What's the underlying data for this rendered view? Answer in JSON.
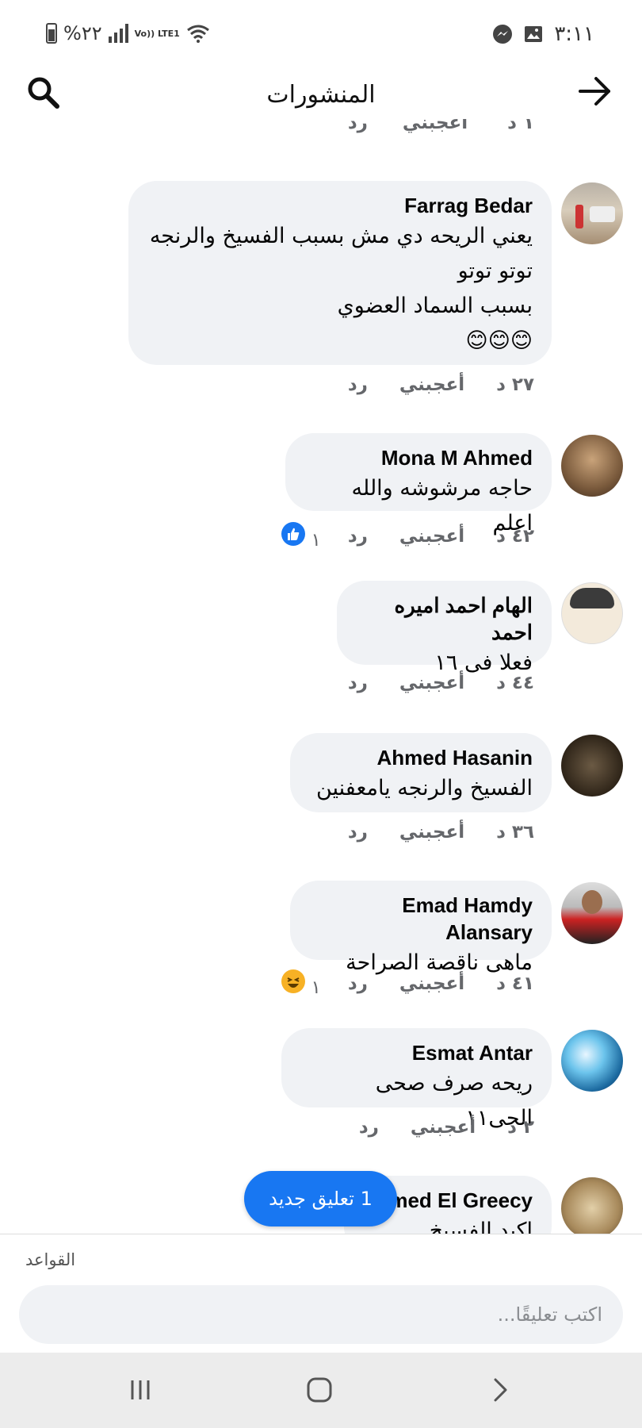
{
  "status_bar": {
    "time": "٣:١١",
    "battery": "%٢٢",
    "network": "Vo)) LTE1"
  },
  "header": {
    "title": "المنشورات",
    "search_icon": "search-icon",
    "back_icon": "arrow-right-icon"
  },
  "partial_top": {
    "time": "١ د",
    "like": "أعجبني",
    "reply": "رد"
  },
  "comments": [
    {
      "name": "Farrag Bedar",
      "text": "يعني الريحه دي مش بسبب الفسيخ والرنجه\nتوتو توتو\nبسبب السماد العضوي\n😊😊😊",
      "time": "٢٧ د",
      "like": "أعجبني",
      "reply": "رد",
      "reaction_count": ""
    },
    {
      "name": "Mona M Ahmed",
      "text": "حاجه مرشوشه والله اعلم",
      "time": "٤٢ د",
      "like": "أعجبني",
      "reply": "رد",
      "reaction_count": "١",
      "reaction": "like"
    },
    {
      "name": "الهام احمد اميره احمد",
      "text": "فعلا فى ١٦",
      "time": "٤٤ د",
      "like": "أعجبني",
      "reply": "رد",
      "reaction_count": ""
    },
    {
      "name": "Ahmed Hasanin",
      "text": "الفسيخ والرنجه يامعفنين",
      "time": "٣٦ د",
      "like": "أعجبني",
      "reply": "رد",
      "reaction_count": ""
    },
    {
      "name": "Emad Hamdy Alansary",
      "text": "ماهى ناقصة الصراحة",
      "time": "٤١ د",
      "like": "أعجبني",
      "reply": "رد",
      "reaction_count": "١",
      "reaction": "haha"
    },
    {
      "name": "Esmat Antar",
      "text": "ريحه صرف صحى الحى١١",
      "time": "٢ د",
      "like": "أعجبني",
      "reply": "رد",
      "reaction_count": ""
    },
    {
      "name": "med El Greecy",
      "text": "اكيد الفسيخ"
    }
  ],
  "new_comment_pill": "1 تعليق جديد",
  "composer": {
    "rules": "القواعد",
    "placeholder": "اكتب تعليقًا..."
  },
  "colors": {
    "accent": "#1877f2",
    "bubble": "#f0f2f5",
    "muted": "#65676b"
  }
}
